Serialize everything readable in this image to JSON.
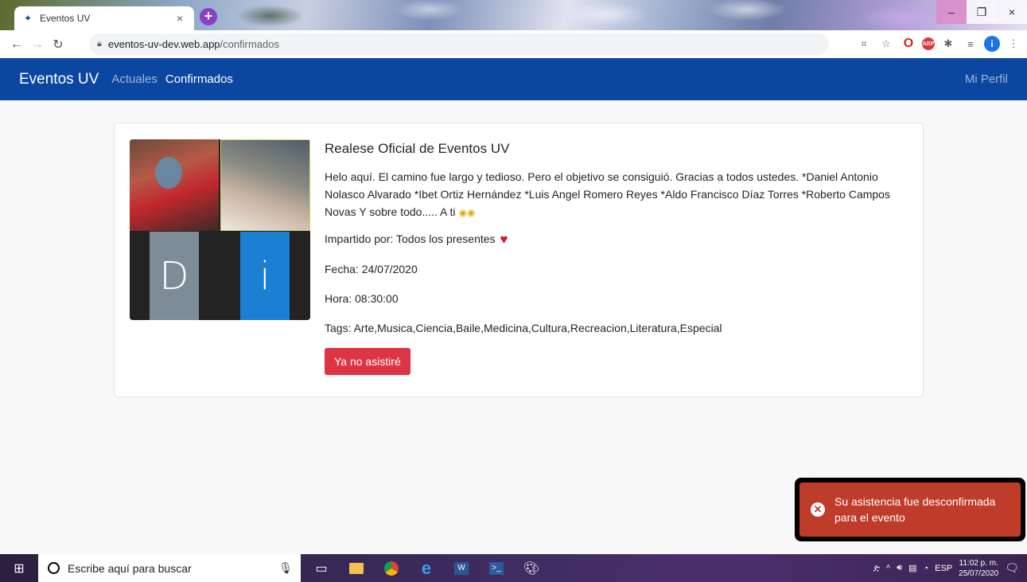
{
  "browser": {
    "tab_title": "Eventos UV",
    "tab_close": "×",
    "new_tab": "+",
    "url_host": "eventos-uv-dev.web.app",
    "url_path": "/confirmados",
    "window_controls": [
      "–",
      "❐",
      "×"
    ]
  },
  "navbar": {
    "brand": "Eventos UV",
    "links": [
      "Actuales",
      "Confirmados"
    ],
    "active_link": "Confirmados",
    "profile": "Mi Perfil"
  },
  "event": {
    "title": "Realese Oficial de Eventos UV",
    "description": "Helo aquí. El camino fue largo y tedioso. Pero el objetivo se consiguió. Gracias a todos ustedes. *Daniel Antonio Nolasco Alvarado *Ibet Ortiz Hernández *Luis Angel Romero Reyes *Aldo Francisco Díaz Torres *Roberto Campos Novas Y sobre todo..... A ti",
    "instructor": "Impartido por: Todos los presentes",
    "date": "Fecha: 24/07/2020",
    "time": "Hora: 08:30:00",
    "tags": "Tags: Arte,Musica,Ciencia,Baile,Medicina,Cultura,Recreacion,Literatura,Especial",
    "cancel_button": "Ya no asistiré",
    "image_tiles": [
      "D",
      "i"
    ]
  },
  "toast": {
    "message_line1": "Su asistencia fue desconfirmada",
    "message_line2": "para el evento",
    "color": "#bf3c2b"
  },
  "taskbar": {
    "search_placeholder": "Escribe aquí para buscar",
    "language": "ESP",
    "time": "11:02 p. m.",
    "date": "25/07/2020"
  },
  "colors": {
    "navbar": "#0b47a1",
    "danger": "#dc3545"
  }
}
